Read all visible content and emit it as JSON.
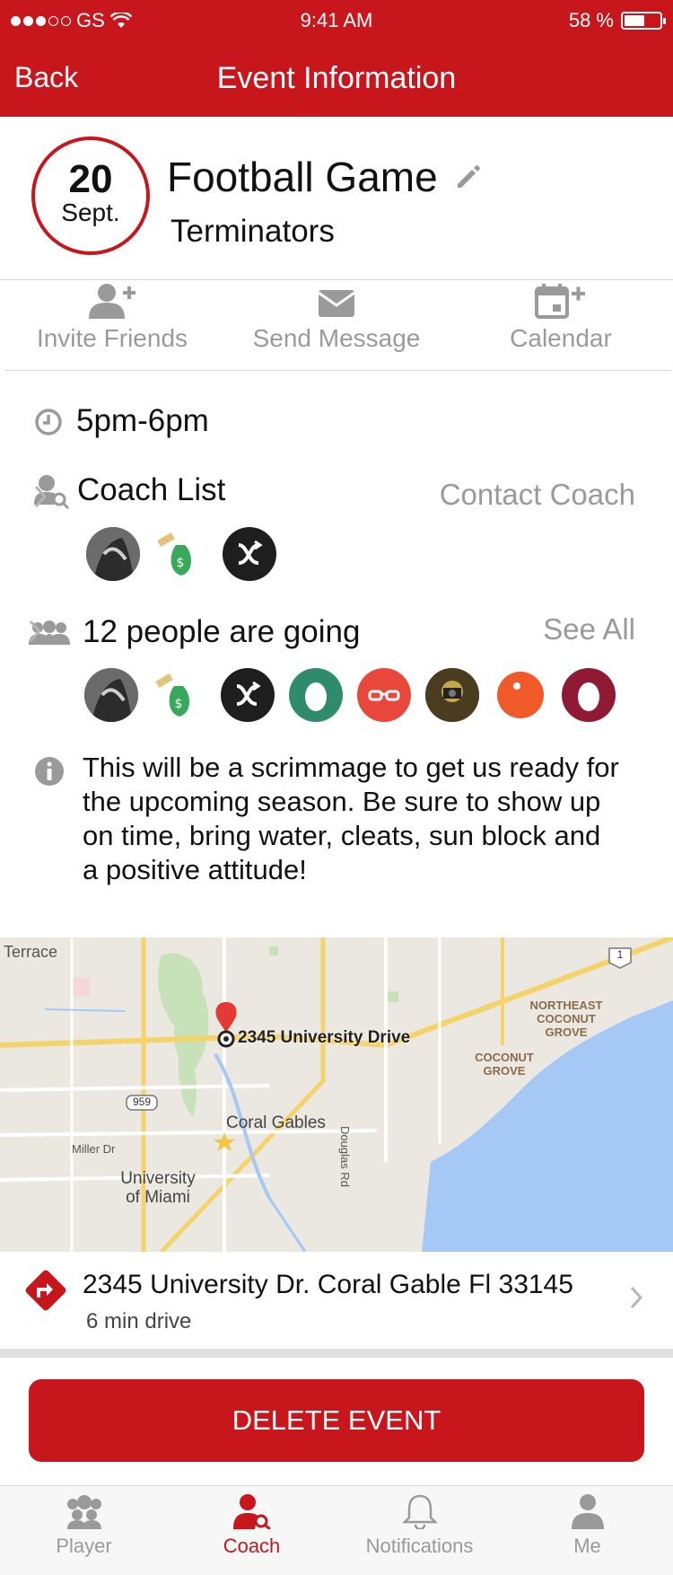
{
  "status_bar": {
    "carrier": "GS",
    "time": "9:41 AM",
    "battery": "58 %",
    "battery_level": 0.58
  },
  "nav": {
    "back_label": "Back",
    "title": "Event Information"
  },
  "event": {
    "day": "20",
    "month": "Sept.",
    "title": "Football Game",
    "team": "Terminators"
  },
  "actions": [
    {
      "label": "Invite Friends",
      "icon": "add-user-icon"
    },
    {
      "label": "Send Message",
      "icon": "envelope-icon"
    },
    {
      "label": "Calendar",
      "icon": "calendar-add-icon"
    }
  ],
  "time": "5pm-6pm",
  "coach": {
    "label": "Coach List",
    "link": "Contact Coach"
  },
  "going": {
    "label": "12 people are going",
    "link": "See All"
  },
  "description": "This will be a scrimmage to get us ready for the upcoming season. Be sure to show up on time, bring water, cleats, sun block and a positive attitude!",
  "map": {
    "pin_label": "2345 University Drive",
    "labels": [
      "Terrace",
      "NORTHEAST COCONUT GROVE",
      "COCONUT GROVE",
      "Coral Gables",
      "Miller Dr",
      "University of Miami",
      "Douglas Rd",
      "959",
      "1"
    ]
  },
  "address": {
    "line": "2345 University Dr. Coral Gable Fl 33145",
    "drive": "6 min drive"
  },
  "delete_label": "DELETE EVENT",
  "tabs": [
    {
      "label": "Player",
      "icon": "team-icon"
    },
    {
      "label": "Coach",
      "icon": "coach-icon"
    },
    {
      "label": "Notifications",
      "icon": "bell-icon"
    },
    {
      "label": "Me",
      "icon": "person-icon"
    }
  ],
  "colors": {
    "accent": "#C8161D",
    "muted": "#9a9a9a"
  }
}
